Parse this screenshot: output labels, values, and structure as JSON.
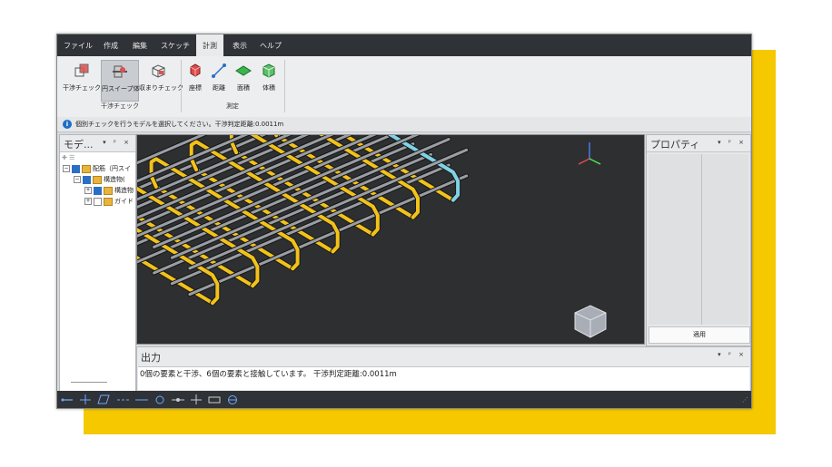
{
  "menu": [
    "ファイル",
    "作成",
    "編集",
    "スケッチ",
    "計測",
    "表示",
    "ヘルプ"
  ],
  "menu_active": "計測",
  "ribbon": {
    "interference_buttons": [
      "干渉チェック",
      "円スイープ体",
      "収まりチェック"
    ],
    "interference_group": "干渉チェック",
    "measure_buttons": [
      "座標",
      "距離",
      "面積",
      "体積"
    ],
    "measure_group": "測定"
  },
  "info_message": "個別チェックを行うモデルを選択してください。干渉判定距離:0.0011m",
  "model_panel": {
    "title": "モデ...",
    "controls": "▾ ᵖ ×",
    "tree": [
      "配筋（円スイ",
      "構造物(",
      "構造物",
      "ガイド"
    ]
  },
  "property_panel": {
    "title": "プロパティ",
    "controls": "▾ ᵖ ×",
    "apply_label": "適用"
  },
  "output_panel": {
    "title": "出力",
    "message": "0個の要素と干渉、6個の要素と接触しています。 干渉判定距離:0.0011m"
  },
  "colors": {
    "bar_yellow": "#f2c21a",
    "bar_gray": "#9a9ea4",
    "bar_highlight": "#7fd3e6",
    "viewport_bg": "#2e2f31",
    "brand_yellow": "#f5c800"
  },
  "status_icons": [
    "line-tool-icon",
    "point-tool-icon",
    "plane-tool-icon",
    "dash-line-icon",
    "horizontal-line-icon",
    "circle-snap-icon",
    "node-line-icon",
    "move-icon",
    "grid-icon",
    "globe-icon"
  ]
}
